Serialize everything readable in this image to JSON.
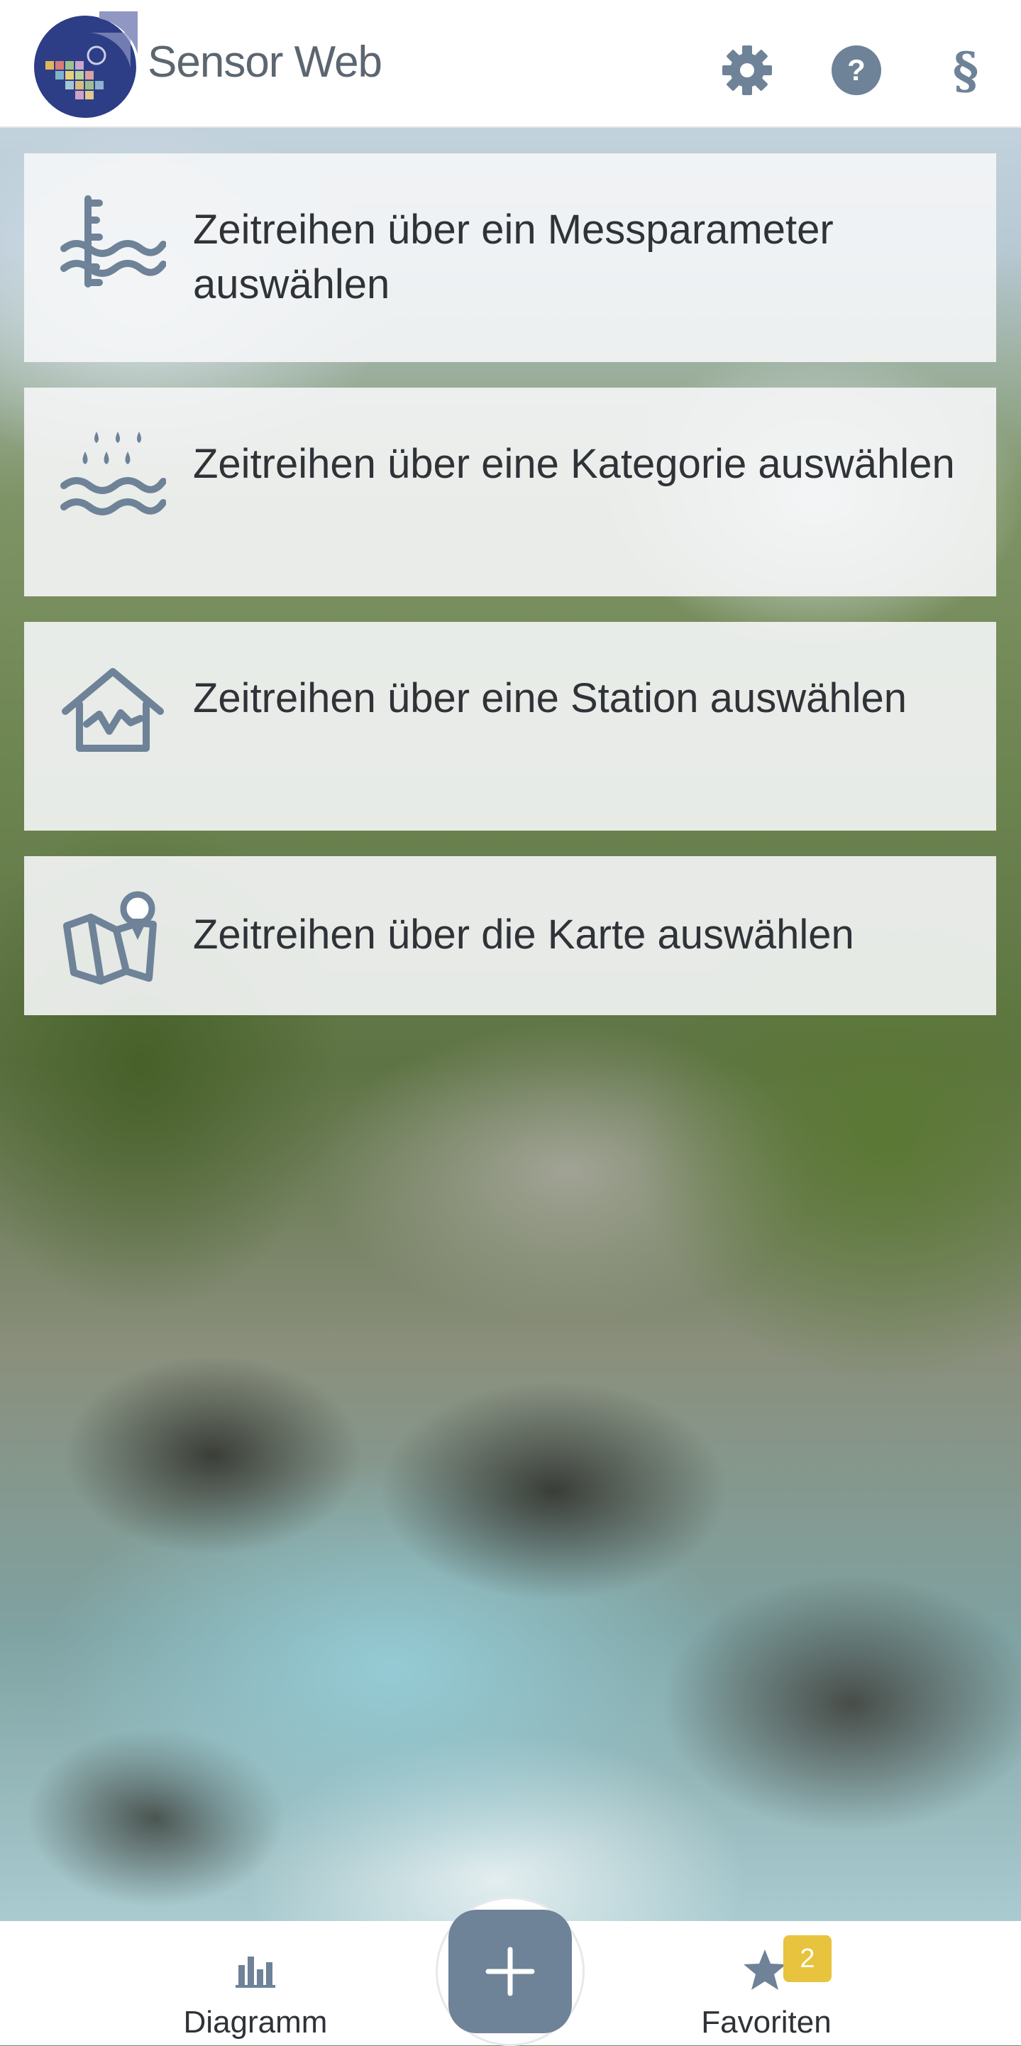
{
  "header": {
    "brand": "Sensor Web",
    "actions": [
      "gear-icon",
      "help-icon",
      "legal-icon"
    ],
    "help_glyph": "?",
    "legal_glyph": "§"
  },
  "menu": {
    "items": [
      {
        "label": "Zeitreihen über ein Messparameter auswählen",
        "icon": "gauge-water-icon"
      },
      {
        "label": "Zeitreihen über eine Kategorie auswählen",
        "icon": "rain-water-icon"
      },
      {
        "label": "Zeitreihen über eine Station auswählen",
        "icon": "station-house-icon"
      },
      {
        "label": "Zeitreihen über die Karte auswählen",
        "icon": "map-pin-icon"
      }
    ]
  },
  "bottom_nav": {
    "diagram_label": "Diagramm",
    "favorites_label": "Favoriten",
    "favorites_count": "2",
    "add_icon": "plus-icon"
  },
  "colors": {
    "accent": "#6e8298",
    "badge": "#e8c33d",
    "text": "#2f3237"
  }
}
